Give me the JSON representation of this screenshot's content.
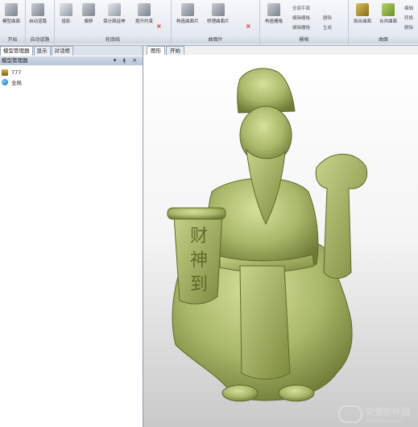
{
  "ribbon": {
    "groups": [
      {
        "label": "开始",
        "buttons": [
          "模型曲面"
        ]
      },
      {
        "label": "自动道路",
        "buttons": [
          "自动道路"
        ]
      },
      {
        "label": "轮廓线",
        "buttons": [
          "投影",
          "偏移",
          "保分面延伸",
          "提升约束"
        ]
      },
      {
        "label": "曲面片",
        "buttons": [
          "构造曲面片",
          "修理曲面片"
        ]
      },
      {
        "label": "栅格",
        "buttons": [
          "构造栅格",
          "全部平面",
          "编辑栅格",
          "编辑栅格",
          "删除",
          "编辑",
          "生成"
        ]
      },
      {
        "label": "曲面",
        "buttons": [
          "拟合曲面",
          "合并曲面",
          "编辑",
          "转换",
          "删除"
        ]
      }
    ]
  },
  "left_panel": {
    "tabs": [
      "模型管理器",
      "显示",
      "对话框"
    ],
    "title": "模型管理器",
    "controls": [
      "▾",
      "ǂ",
      "×"
    ],
    "tree": [
      {
        "label": "777",
        "icon": "award-icon"
      },
      {
        "label": "全局",
        "icon": "globe-icon"
      }
    ]
  },
  "viewport": {
    "tabs": [
      "图形",
      "开始"
    ],
    "scroll_text": [
      "财",
      "神",
      "到"
    ]
  },
  "watermark": {
    "main": "安素软件园",
    "sub": "www.anxz.com"
  },
  "colors": {
    "model": "#a9b86a",
    "model_dark": "#5e6a2a",
    "ribbon": "#dfe5ee"
  }
}
